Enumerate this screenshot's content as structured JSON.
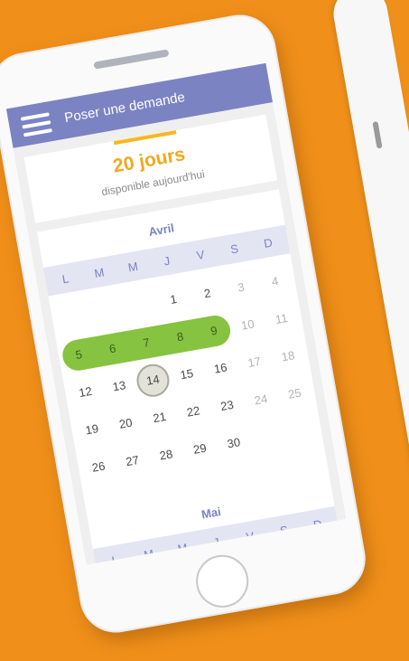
{
  "appbar": {
    "title": "Poser une demande",
    "menu_icon": "hamburger-menu-icon",
    "color": "#7B83C3"
  },
  "balance": {
    "days": "20 jours",
    "caption": "disponible aujourd'hui",
    "accent_color": "#F4A71C"
  },
  "calendar": {
    "weekdays": [
      "L",
      "M",
      "M",
      "J",
      "V",
      "S",
      "D"
    ],
    "april": {
      "title": "Avril",
      "first_weekday_index": 3,
      "days_in_month": 30,
      "selected_range": [
        5,
        9
      ],
      "today": 14
    },
    "may": {
      "title": "Mai"
    },
    "range_color": "#86C341",
    "weekend_color": "#B4B4B4"
  }
}
